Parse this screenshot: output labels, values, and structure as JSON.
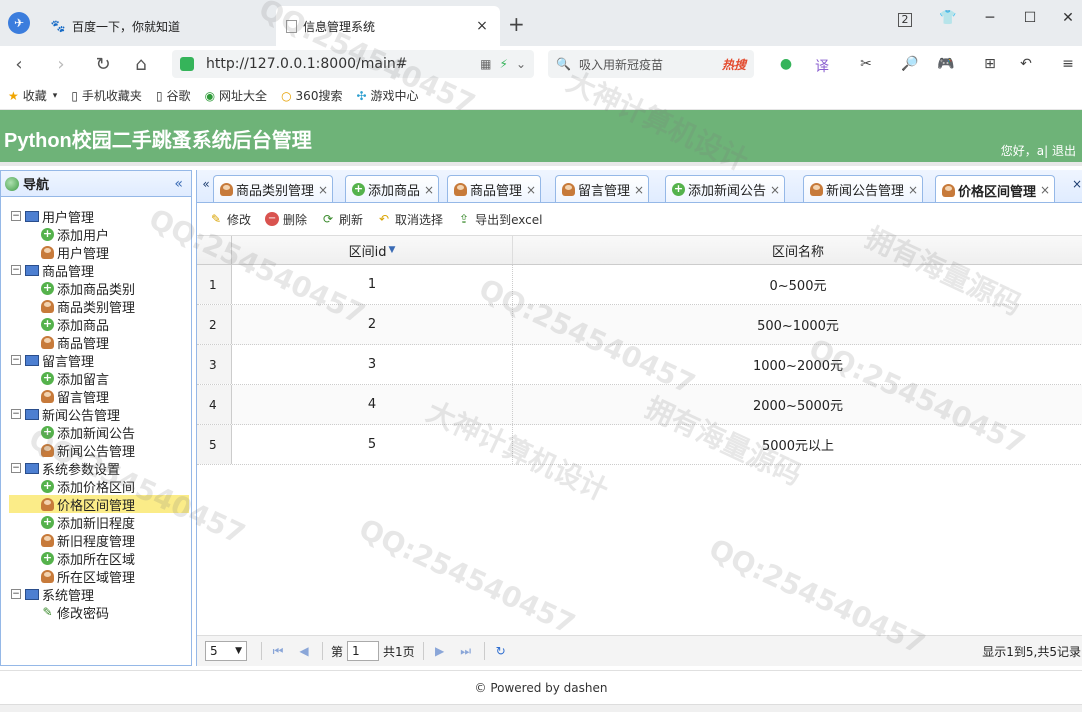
{
  "browser": {
    "tabs": [
      {
        "title": "百度一下，你就知道",
        "active": false
      },
      {
        "title": "信息管理系统",
        "active": true
      }
    ],
    "url": "http://127.0.0.1:8000/main#",
    "search_placeholder": "吸入用新冠疫苗",
    "search_hot": "热搜",
    "bookmarks": [
      "收藏",
      "手机收藏夹",
      "谷歌",
      "网址大全",
      "360搜索",
      "游戏中心"
    ]
  },
  "header": {
    "title": "Python校园二手跳蚤系统后台管理",
    "user_text": "您好，a| 退出"
  },
  "nav": {
    "title": "导航",
    "groups": [
      {
        "label": "用户管理",
        "children": [
          {
            "label": "添加用户",
            "icon": "add"
          },
          {
            "label": "用户管理",
            "icon": "user"
          }
        ]
      },
      {
        "label": "商品管理",
        "children": [
          {
            "label": "添加商品类别",
            "icon": "add"
          },
          {
            "label": "商品类别管理",
            "icon": "user"
          },
          {
            "label": "添加商品",
            "icon": "add"
          },
          {
            "label": "商品管理",
            "icon": "user"
          }
        ]
      },
      {
        "label": "留言管理",
        "children": [
          {
            "label": "添加留言",
            "icon": "add"
          },
          {
            "label": "留言管理",
            "icon": "user"
          }
        ]
      },
      {
        "label": "新闻公告管理",
        "children": [
          {
            "label": "添加新闻公告",
            "icon": "add"
          },
          {
            "label": "新闻公告管理",
            "icon": "user"
          }
        ]
      },
      {
        "label": "系统参数设置",
        "children": [
          {
            "label": "添加价格区间",
            "icon": "add"
          },
          {
            "label": "价格区间管理",
            "icon": "user",
            "selected": true
          },
          {
            "label": "添加新旧程度",
            "icon": "add"
          },
          {
            "label": "新旧程度管理",
            "icon": "user"
          },
          {
            "label": "添加所在区域",
            "icon": "add"
          },
          {
            "label": "所在区域管理",
            "icon": "user"
          }
        ]
      },
      {
        "label": "系统管理",
        "children": [
          {
            "label": "修改密码",
            "icon": "pencil"
          }
        ]
      }
    ]
  },
  "tabs": [
    {
      "label": "商品类别管理",
      "icon": "user",
      "close": "×"
    },
    {
      "label": "添加商品",
      "icon": "add",
      "close": "×"
    },
    {
      "label": "商品管理",
      "icon": "user",
      "close": "×"
    },
    {
      "label": "留言管理",
      "icon": "user",
      "close": "×"
    },
    {
      "label": "添加新闻公告",
      "icon": "add",
      "close": "×"
    },
    {
      "label": "新闻公告管理",
      "icon": "user",
      "close": "×"
    },
    {
      "label": "价格区间管理",
      "icon": "user",
      "close": "×",
      "active": true
    }
  ],
  "toolbar": {
    "edit": "修改",
    "delete": "删除",
    "refresh": "刷新",
    "clear": "取消选择",
    "export": "导出到excel"
  },
  "grid": {
    "columns": [
      "区间id",
      "区间名称"
    ],
    "rows": [
      {
        "rownum": "1",
        "id": "1",
        "name": "0~500元"
      },
      {
        "rownum": "2",
        "id": "2",
        "name": "500~1000元"
      },
      {
        "rownum": "3",
        "id": "3",
        "name": "1000~2000元"
      },
      {
        "rownum": "4",
        "id": "4",
        "name": "2000~5000元"
      },
      {
        "rownum": "5",
        "id": "5",
        "name": "5000元以上"
      }
    ]
  },
  "pager": {
    "page_size": "5",
    "page_prefix": "第",
    "page_value": "1",
    "page_suffix": "共1页",
    "info": "显示1到5,共5记录"
  },
  "footer": "© Powered by dashen",
  "watermarks": [
    "QQ:254540457",
    "大神计算机设计",
    "拥有海量源码"
  ]
}
